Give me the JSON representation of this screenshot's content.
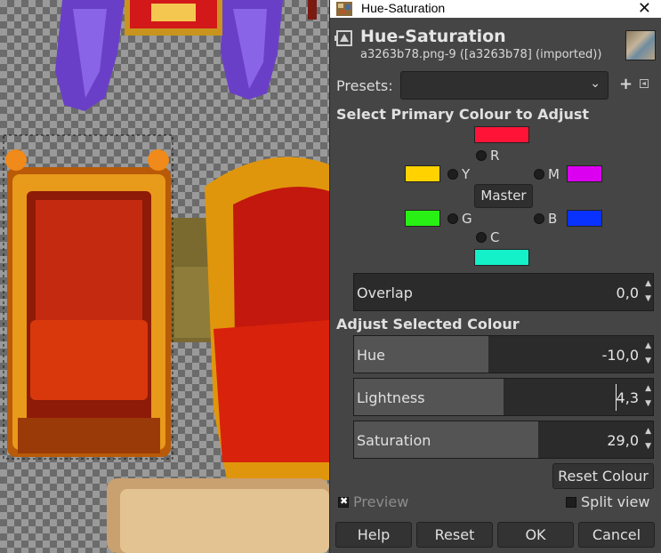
{
  "window": {
    "title": "Hue-Saturation",
    "close_glyph": "✕"
  },
  "header": {
    "title": "Hue-Saturation",
    "subtitle": "a3263b78.png-9 ([a3263b78] (imported))"
  },
  "presets": {
    "label": "Presets:",
    "value": ""
  },
  "primary": {
    "title": "Select Primary Colour to Adjust",
    "colors": {
      "R": {
        "label": "R",
        "hex": "#ff1438"
      },
      "Y": {
        "label": "Y",
        "hex": "#ffd200"
      },
      "M": {
        "label": "M",
        "hex": "#dc00f0"
      },
      "G": {
        "label": "G",
        "hex": "#28f014"
      },
      "B": {
        "label": "B",
        "hex": "#0a32ff"
      },
      "C": {
        "label": "C",
        "hex": "#14f0c8"
      }
    },
    "master_label": "Master"
  },
  "overlap": {
    "label": "Overlap",
    "value": "0,0",
    "fraction": 0.0
  },
  "adjust": {
    "title": "Adjust Selected Colour",
    "hue": {
      "label": "Hue",
      "value": "-10,0",
      "fraction": 0.45
    },
    "lightness": {
      "label": "Lightness",
      "value": "4,3",
      "fraction": 0.5
    },
    "saturation": {
      "label": "Saturation",
      "value": "29,0",
      "fraction": 0.615
    }
  },
  "reset_colour_label": "Reset Colour",
  "preview": {
    "label": "Preview",
    "checked": true
  },
  "split_view": {
    "label": "Split view",
    "checked": false
  },
  "buttons": {
    "help": "Help",
    "reset": "Reset",
    "ok": "OK",
    "cancel": "Cancel"
  },
  "icons": {
    "app": "hue-saturation-icon",
    "header": "hue-saturation-tool-icon",
    "presets_add": "plus-icon",
    "presets_menu": "menu-icon"
  }
}
